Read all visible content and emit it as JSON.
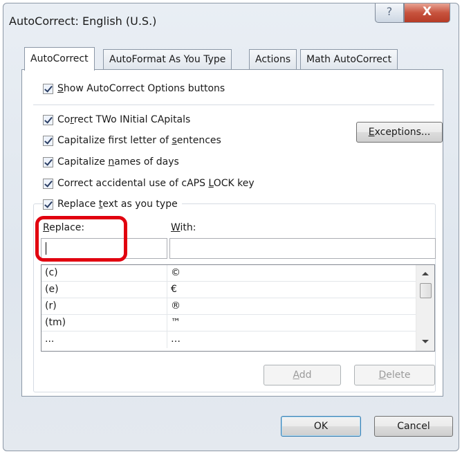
{
  "window": {
    "title": "AutoCorrect: English (U.S.)",
    "help_glyph": "?",
    "close_glyph": "X"
  },
  "tabs": [
    {
      "label": "AutoCorrect",
      "active": true
    },
    {
      "label": "AutoFormat As You Type",
      "active": false
    },
    {
      "label": "Actions",
      "active": false
    },
    {
      "label": "Math AutoCorrect",
      "active": false
    }
  ],
  "options": {
    "show_buttons": {
      "pre": "",
      "key": "S",
      "post": "how AutoCorrect Options buttons",
      "checked": true
    },
    "two_initial": {
      "pre": "Co",
      "key": "r",
      "post": "rect TWo INitial CApitals",
      "checked": true
    },
    "first_letter": {
      "pre": "Capitalize first letter of ",
      "key": "s",
      "post": "entences",
      "checked": true
    },
    "days": {
      "pre": "Capitalize ",
      "key": "n",
      "post": "ames of days",
      "checked": true
    },
    "caps_lock": {
      "pre": "Correct accidental use of cAPS ",
      "key": "L",
      "post": "OCK key",
      "checked": true
    },
    "replace_text": {
      "pre": "Replace ",
      "key": "t",
      "post": "ext as you type",
      "checked": true
    }
  },
  "buttons": {
    "exceptions": {
      "key": "E",
      "rest": "xceptions..."
    },
    "add": {
      "key": "A",
      "rest": "dd"
    },
    "delete": {
      "key": "D",
      "rest": "elete"
    },
    "ok": "OK",
    "cancel": "Cancel"
  },
  "replace_label": {
    "key": "R",
    "rest": "eplace:"
  },
  "with_label": {
    "key": "W",
    "rest": "ith:"
  },
  "replace_value": "",
  "with_value": "",
  "entries": [
    {
      "replace": "(c)",
      "with": "©"
    },
    {
      "replace": "(e)",
      "with": "€"
    },
    {
      "replace": "(r)",
      "with": "®"
    },
    {
      "replace": "(tm)",
      "with": "™"
    },
    {
      "replace": "...",
      "with": "…"
    }
  ],
  "colors": {
    "highlight": "#e1000f",
    "close": "#c7533e"
  }
}
